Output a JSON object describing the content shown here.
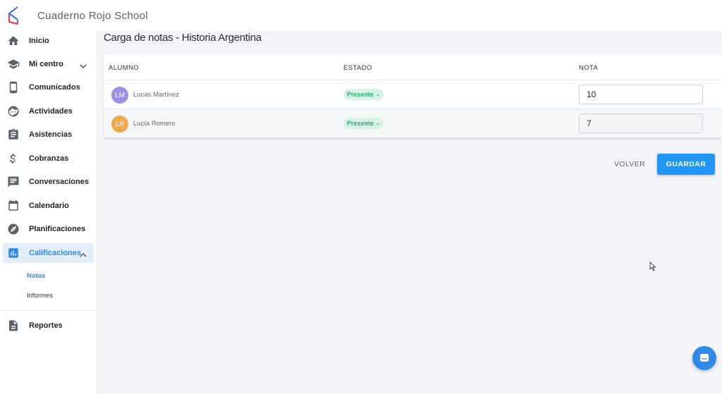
{
  "app": {
    "title": "Cuaderno Rojo School"
  },
  "sidebar": {
    "items": [
      {
        "label": "Inicio",
        "icon": "home-icon"
      },
      {
        "label": "Mi centro",
        "icon": "school-icon"
      },
      {
        "label": "Comunicados",
        "icon": "phone-icon"
      },
      {
        "label": "Actividades",
        "icon": "face-icon"
      },
      {
        "label": "Asistencias",
        "icon": "clipboard-icon"
      },
      {
        "label": "Cobranzas",
        "icon": "dollar-icon"
      },
      {
        "label": "Conversaciones",
        "icon": "chat-icon"
      },
      {
        "label": "Calendario",
        "icon": "calendar-icon"
      },
      {
        "label": "Planificaciones",
        "icon": "compass-icon"
      },
      {
        "label": "Calificaciones",
        "icon": "chart-icon"
      },
      {
        "label": "Reportes",
        "icon": "document-icon"
      }
    ],
    "subitems": [
      {
        "label": "Notas"
      },
      {
        "label": "Informes"
      }
    ]
  },
  "main": {
    "title": "Carga de notas - Historia Argentina",
    "table": {
      "columns": [
        "ALUMNO",
        "ESTADO",
        "NOTA"
      ],
      "rows": [
        {
          "initials": "LM",
          "name": "Lucas Martínez",
          "status": "Presente",
          "grade": "10",
          "avatar_color": "#9b8ee6"
        },
        {
          "initials": "LR",
          "name": "Lucía Romero",
          "status": "Presente",
          "grade": "7",
          "avatar_color": "#f2a84a"
        }
      ]
    },
    "actions": {
      "back_label": "VOLVER",
      "save_label": "GUARDAR"
    }
  },
  "colors": {
    "accent": "#2e8ae6",
    "primary_button": "#2196f3",
    "status_green": "#27ae72"
  }
}
